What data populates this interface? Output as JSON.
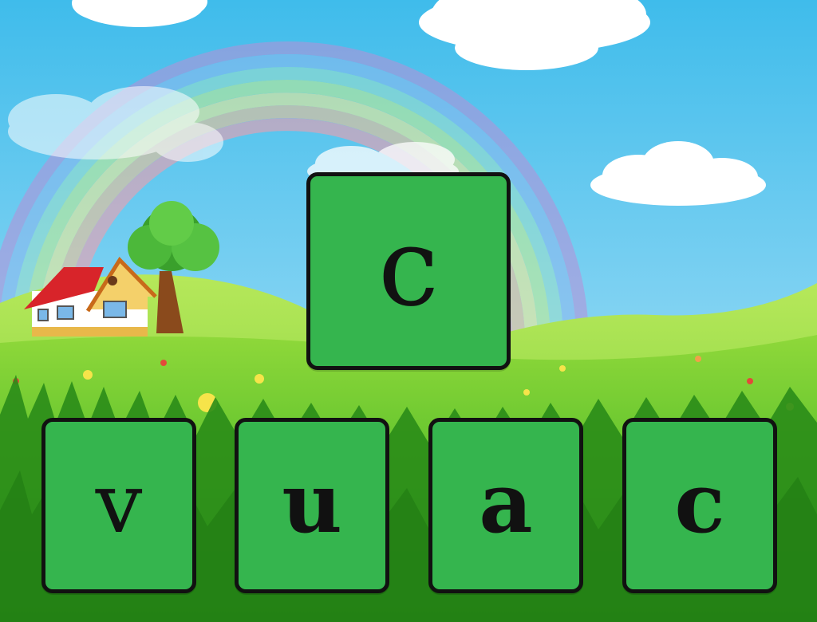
{
  "colors": {
    "tile_fill": "#35b54e",
    "tile_border": "#111111",
    "letter": "#111111",
    "sky_top": "#4cc2ee",
    "sky_bottom": "#a6e2f6",
    "grass_light": "#8fd83a",
    "grass_dark": "#2e9b1c"
  },
  "target": {
    "letter": "c"
  },
  "choices": [
    {
      "letter": "v"
    },
    {
      "letter": "u"
    },
    {
      "letter": "a"
    },
    {
      "letter": "c"
    }
  ],
  "scenery": [
    "rainbow-icon",
    "cloud-icon",
    "house-icon",
    "tree-icon",
    "flower-icon"
  ]
}
